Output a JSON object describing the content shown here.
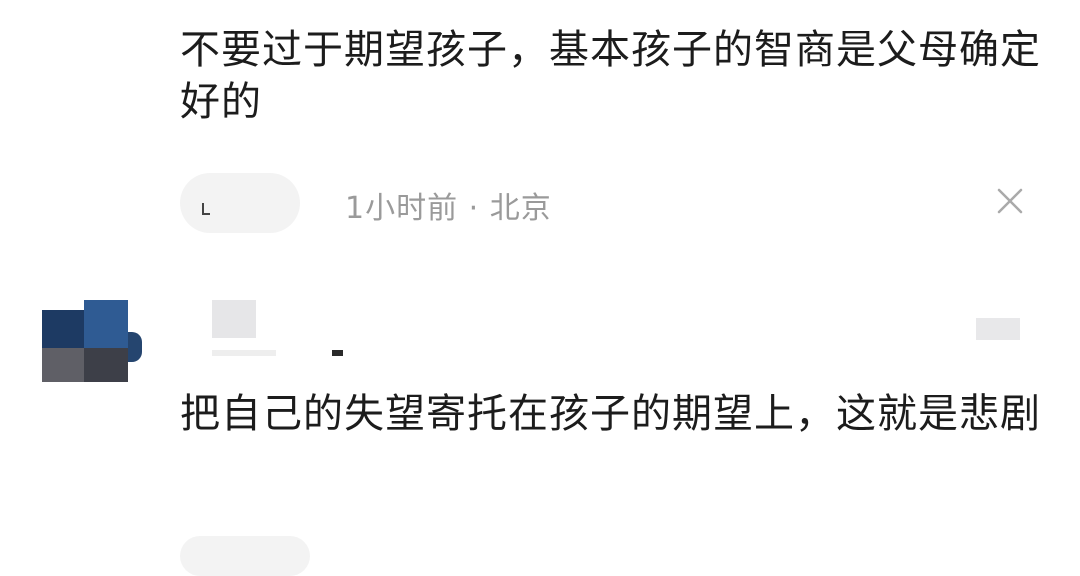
{
  "comments": [
    {
      "text": "不要过于期望孩子，基本孩子的智商是父母确定好的",
      "meta": "1小时前 · 北京",
      "close_icon": "close-icon"
    },
    {
      "text": "把自己的失望寄托在孩子的期望上，这就是悲剧"
    }
  ],
  "colors": {
    "text": "#1c1c1c",
    "meta": "#9a9a9a",
    "placeholder": "#f3f3f3"
  }
}
